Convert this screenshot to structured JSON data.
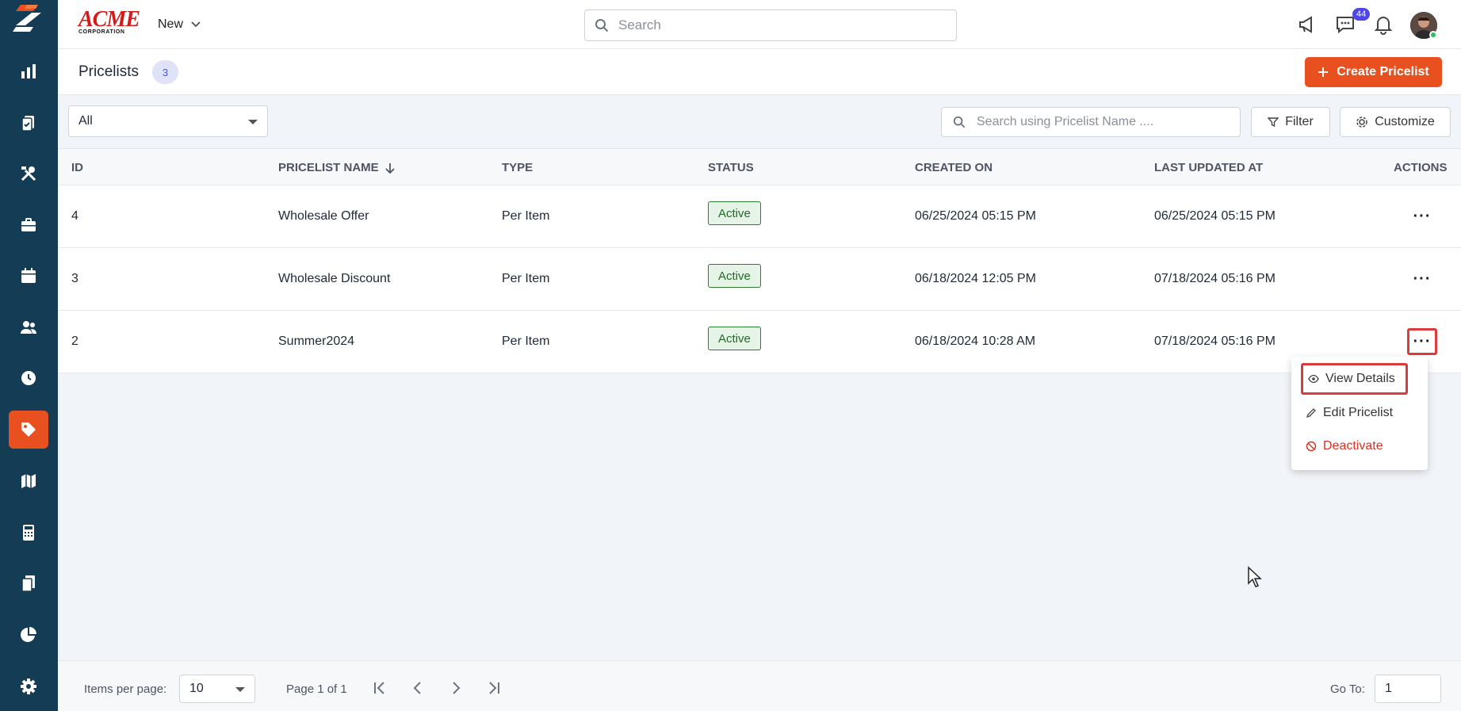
{
  "app": {
    "brand": {
      "name": "ACME",
      "sub": "CORPORATION"
    },
    "new_menu_label": "New",
    "search_placeholder": "Search",
    "notification_count": "44"
  },
  "sidebar": {
    "items": [
      {
        "icon": "bar-chart-icon"
      },
      {
        "icon": "clipboard-icon"
      },
      {
        "icon": "tools-icon"
      },
      {
        "icon": "briefcase-icon"
      },
      {
        "icon": "calendar-icon"
      },
      {
        "icon": "users-icon"
      },
      {
        "icon": "clock-icon"
      },
      {
        "icon": "price-tag-icon",
        "active": true
      },
      {
        "icon": "map-icon"
      },
      {
        "icon": "calculator-icon"
      },
      {
        "icon": "documents-icon"
      },
      {
        "icon": "pie-chart-icon"
      },
      {
        "icon": "gear-icon"
      }
    ]
  },
  "header": {
    "title": "Pricelists",
    "count": "3",
    "create_label": "Create Pricelist"
  },
  "filters": {
    "status_value": "All",
    "search_placeholder": "Search using Pricelist Name ....",
    "filter_label": "Filter",
    "customize_label": "Customize"
  },
  "table": {
    "columns": [
      "ID",
      "PRICELIST NAME",
      "TYPE",
      "STATUS",
      "CREATED ON",
      "LAST UPDATED AT",
      "ACTIONS"
    ],
    "rows": [
      {
        "id": "4",
        "name": "Wholesale Offer",
        "type": "Per Item",
        "status": "Active",
        "created": "06/25/2024 05:15 PM",
        "updated": "06/25/2024 05:15 PM"
      },
      {
        "id": "3",
        "name": "Wholesale Discount",
        "type": "Per Item",
        "status": "Active",
        "created": "06/18/2024 12:05 PM",
        "updated": "07/18/2024 05:16 PM"
      },
      {
        "id": "2",
        "name": "Summer2024",
        "type": "Per Item",
        "status": "Active",
        "created": "06/18/2024 10:28 AM",
        "updated": "07/18/2024 05:16 PM"
      }
    ],
    "actions_glyph": "···"
  },
  "action_menu": {
    "items": [
      {
        "label": "View Details",
        "icon": "eye-icon"
      },
      {
        "label": "Edit Pricelist",
        "icon": "pencil-icon"
      },
      {
        "label": "Deactivate",
        "icon": "ban-icon"
      }
    ]
  },
  "footer": {
    "items_per_page_label": "Items per page:",
    "items_per_page_value": "10",
    "page_info": "Page 1 of 1",
    "goto_label": "Go To:",
    "goto_value": "1"
  },
  "colors": {
    "sidebar": "#143c55",
    "accent": "#e8501f",
    "status_active": "#2e7d32",
    "highlight": "#dc3b3b"
  }
}
